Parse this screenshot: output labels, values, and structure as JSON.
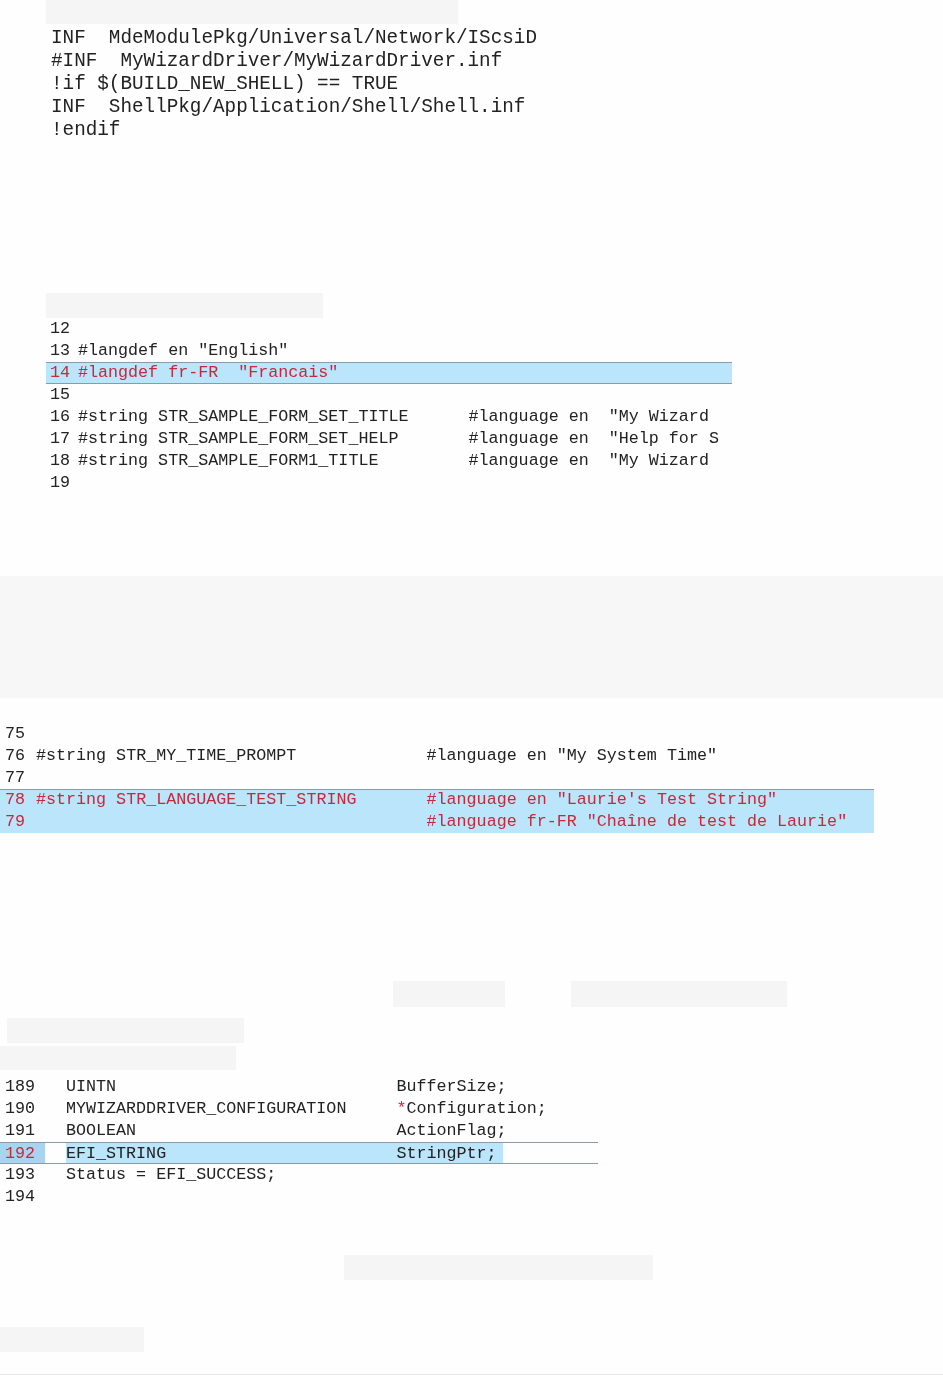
{
  "snippets": [
    {
      "kind": "plain",
      "lines": [
        {
          "text": "INF  MdeModulePkg/Universal/Network/IScsiD"
        },
        {
          "text": "#INF  MyWizardDriver/MyWizardDriver.inf"
        },
        {
          "text": "!if $(BUILD_NEW_SHELL) == TRUE"
        },
        {
          "text": "INF  ShellPkg/Application/Shell/Shell.inf"
        },
        {
          "text": "!endif"
        }
      ]
    },
    {
      "kind": "numbered",
      "lines": [
        {
          "number": "12",
          "highlighted": false
        },
        {
          "number": "13",
          "text": "#langdef en \"English\"",
          "highlighted": false
        },
        {
          "number": "14",
          "text": "#langdef fr-FR  \"Francais\"",
          "highlighted": true
        },
        {
          "number": "15",
          "highlighted": false
        },
        {
          "number": "16",
          "text": "#string STR_SAMPLE_FORM_SET_TITLE      #language en  \"My Wizard",
          "highlighted": false
        },
        {
          "number": "17",
          "text": "#string STR_SAMPLE_FORM_SET_HELP       #language en  \"Help for S",
          "highlighted": false
        },
        {
          "number": "18",
          "text": "#string STR_SAMPLE_FORM1_TITLE         #language en  \"My Wizard",
          "highlighted": false
        },
        {
          "number": "19",
          "highlighted": false
        }
      ]
    },
    {
      "kind": "numbered",
      "lines": [
        {
          "number": "75",
          "highlighted": false
        },
        {
          "number": "76",
          "text": "#string STR_MY_TIME_PROMPT             #language en \"My System Time\"",
          "highlighted": false
        },
        {
          "number": "77",
          "highlighted": false
        },
        {
          "number": "78",
          "text": "#string STR_LANGUAGE_TEST_STRING       #language en \"Laurie's Test String\"",
          "highlighted": true
        },
        {
          "number": "79",
          "text": "                                       #language fr-FR \"Chaîne de test de Laurie\"",
          "highlighted": true
        }
      ]
    },
    {
      "kind": "gutter",
      "lines": [
        {
          "number": "189",
          "text": "UINTN                            BufferSize;",
          "highlighted": false
        },
        {
          "number": "190",
          "segments": [
            {
              "kind": "plain",
              "text": "MYWIZARDDRIVER_CONFIGURATION     "
            },
            {
              "kind": "operator",
              "text": "*"
            },
            {
              "kind": "plain",
              "text": "Configuration;"
            }
          ],
          "highlighted": false
        },
        {
          "number": "191",
          "text": "BOOLEAN                          ActionFlag;",
          "highlighted": false
        },
        {
          "number": "192",
          "text": "EFI_STRING                       StringPtr;",
          "highlighted": true
        },
        {
          "number": "193",
          "text": "Status = EFI_SUCCESS;",
          "highlighted": false
        },
        {
          "number": "194",
          "highlighted": false
        }
      ]
    }
  ]
}
